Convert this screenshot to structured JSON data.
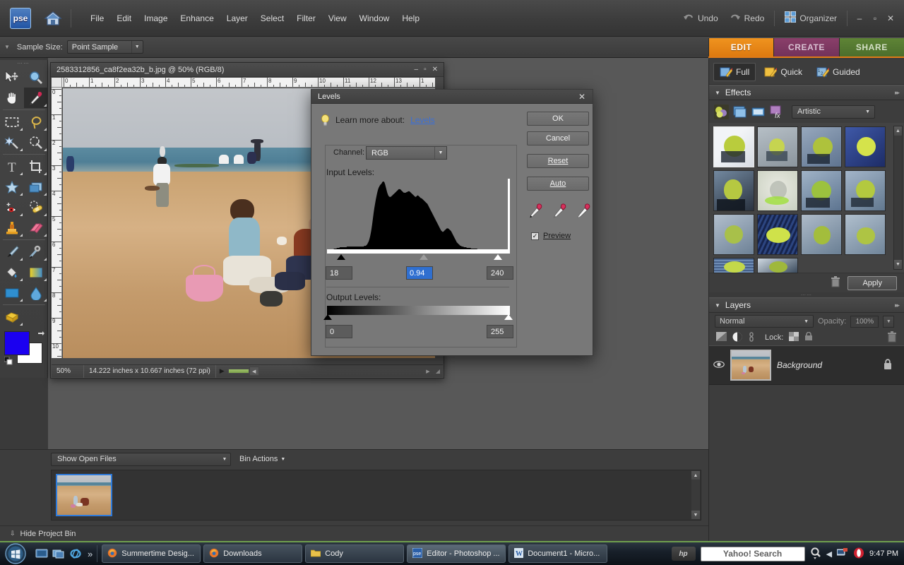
{
  "app": {
    "logo_text": "pse",
    "menus": [
      "File",
      "Edit",
      "Image",
      "Enhance",
      "Layer",
      "Select",
      "Filter",
      "View",
      "Window",
      "Help"
    ],
    "undo_label": "Undo",
    "redo_label": "Redo",
    "organizer_label": "Organizer",
    "window_buttons": [
      "–",
      "▫",
      "✕"
    ],
    "home_icon": "home-icon",
    "undo_icon": "undo-arrow-icon",
    "redo_icon": "redo-arrow-icon",
    "organizer_icon": "grid-squares-icon"
  },
  "options_bar": {
    "grip_icon": "collapse-triangle-icon",
    "sample_size_label": "Sample Size:",
    "sample_size_value": "Point Sample"
  },
  "mode_tabs": [
    {
      "label": "EDIT",
      "active": true,
      "color": "#e68a1c"
    },
    {
      "label": "CREATE",
      "active": false,
      "color": "#7f3a61"
    },
    {
      "label": "SHARE",
      "active": false,
      "color": "#55792f"
    }
  ],
  "edit_modes": [
    {
      "label": "Full",
      "active": true,
      "icon": "pencil-photo-icon"
    },
    {
      "label": "Quick",
      "active": false,
      "icon": "pencil-photo-icon"
    },
    {
      "label": "Guided",
      "active": false,
      "icon": "numbered-pencil-icon"
    }
  ],
  "effects_panel": {
    "title": "Effects",
    "collapse_icon": "triangle-down-icon",
    "expand_icon": "double-chevron-right-icon",
    "category_buttons": [
      {
        "name": "filters-icon"
      },
      {
        "name": "layer-styles-icon"
      },
      {
        "name": "photo-effects-icon"
      },
      {
        "name": "fx-effects-icon"
      }
    ],
    "category_value": "Artistic",
    "thumbnails": [
      {
        "id": 1,
        "selected": true
      },
      {
        "id": 2,
        "selected": false
      },
      {
        "id": 3,
        "selected": false
      },
      {
        "id": 4,
        "selected": false
      },
      {
        "id": 5,
        "selected": false
      },
      {
        "id": 6,
        "selected": false
      },
      {
        "id": 7,
        "selected": false
      },
      {
        "id": 8,
        "selected": false
      },
      {
        "id": 9,
        "selected": false
      },
      {
        "id": 10,
        "selected": false
      },
      {
        "id": 11,
        "selected": false
      },
      {
        "id": 12,
        "selected": false
      },
      {
        "id": 13,
        "selected": false
      },
      {
        "id": 14,
        "selected": false
      }
    ],
    "trash_icon": "trash-icon",
    "apply_label": "Apply"
  },
  "layers_panel": {
    "title": "Layers",
    "collapse_icon": "triangle-down-icon",
    "expand_icon": "double-chevron-right-icon",
    "blend_mode": "Normal",
    "opacity_label": "Opacity:",
    "opacity_value": "100%",
    "lock_label": "Lock:",
    "icons": [
      "new-fill-layer-icon",
      "new-adjustment-layer-icon",
      "link-layers-icon",
      "lock-transparency-icon",
      "lock-all-icon",
      "trash-icon"
    ],
    "layers": [
      {
        "name": "Background",
        "visible": true,
        "locked": true,
        "visibility_icon": "eye-icon",
        "lock_icon": "padlock-icon"
      }
    ]
  },
  "toolbox": {
    "grip_icon": "dots-grip-icon",
    "tools": [
      {
        "name": "move-tool",
        "selected": false
      },
      {
        "name": "zoom-tool",
        "selected": false
      },
      {
        "name": "hand-tool",
        "selected": false
      },
      {
        "name": "eyedropper-tool",
        "selected": true
      },
      {
        "name": "rectangular-marquee-tool",
        "selected": false
      },
      {
        "name": "lasso-tool",
        "selected": false
      },
      {
        "name": "magic-wand-tool",
        "selected": false
      },
      {
        "name": "quick-selection-tool",
        "selected": false
      },
      {
        "name": "type-tool",
        "selected": false
      },
      {
        "name": "crop-tool",
        "selected": false
      },
      {
        "name": "cookie-cutter-tool",
        "selected": false
      },
      {
        "name": "straighten-tool",
        "selected": false
      },
      {
        "name": "red-eye-removal-tool",
        "selected": false
      },
      {
        "name": "healing-brush-tool",
        "selected": false
      },
      {
        "name": "clone-stamp-tool",
        "selected": false
      },
      {
        "name": "eraser-tool",
        "selected": false
      },
      {
        "name": "brush-tool",
        "selected": false
      },
      {
        "name": "smart-brush-tool",
        "selected": false
      },
      {
        "name": "paint-bucket-tool",
        "selected": false
      },
      {
        "name": "gradient-tool",
        "selected": false
      },
      {
        "name": "shape-tool",
        "selected": false
      },
      {
        "name": "blur-tool",
        "selected": false
      },
      {
        "name": "sponge-tool",
        "selected": false
      }
    ],
    "foreground_color": "#1b00f0",
    "background_color": "#ffffff",
    "swap_icon": "swap-colors-icon",
    "default_colors_icon": "default-colors-icon"
  },
  "document": {
    "title": "2583312856_ca8f2ea32b_b.jpg @ 50% (RGB/8)",
    "window_buttons": [
      "–",
      "▫",
      "✕"
    ],
    "zoom_level": "50%",
    "dimensions": "14.222 inches x 10.667 inches (72 ppi)",
    "ruler_h_labels": [
      "0",
      "1",
      "2",
      "3",
      "4",
      "5",
      "6",
      "7",
      "8",
      "9",
      "10",
      "11",
      "12",
      "13",
      "1"
    ],
    "ruler_v_labels": [
      "0",
      "1",
      "2",
      "3",
      "4",
      "5",
      "6",
      "7",
      "8",
      "9",
      "10"
    ],
    "status_play_icon": "play-triangle-icon"
  },
  "levels_dialog": {
    "title": "Levels",
    "close_icon": "close-x-icon",
    "bulb_icon": "lightbulb-icon",
    "learn_more_prefix": "Learn more about:",
    "learn_more_link": "Levels",
    "channel_label": "Channel:",
    "channel_value": "RGB",
    "input_levels_label": "Input Levels:",
    "input_black": "18",
    "input_gamma": "0.94",
    "input_white": "240",
    "gamma_selected": true,
    "output_levels_label": "Output Levels:",
    "output_black": "0",
    "output_white": "255",
    "buttons": [
      {
        "label": "OK",
        "name": "ok-button"
      },
      {
        "label": "Cancel",
        "name": "cancel-button"
      },
      {
        "label": "Reset",
        "name": "reset-button"
      },
      {
        "label": "Auto",
        "name": "auto-button"
      }
    ],
    "eyedroppers": [
      "set-black-point-eyedropper",
      "set-gray-point-eyedropper",
      "set-white-point-eyedropper"
    ],
    "preview_label": "Preview",
    "preview_checked": true,
    "histogram": [
      2,
      2,
      2,
      2,
      2,
      2,
      3,
      3,
      3,
      3,
      4,
      4,
      4,
      4,
      5,
      5,
      5,
      5,
      6,
      6,
      6,
      6,
      6,
      6,
      6,
      6,
      6,
      6,
      7,
      7,
      7,
      7,
      7,
      7,
      7,
      7,
      7,
      7,
      7,
      7,
      7,
      7,
      7,
      7,
      7,
      7,
      7,
      7,
      7,
      7,
      7,
      7,
      8,
      8,
      8,
      9,
      10,
      12,
      14,
      17,
      21,
      26,
      32,
      39,
      47,
      55,
      62,
      68,
      74,
      79,
      84,
      88,
      91,
      93,
      95,
      96,
      97,
      99,
      100,
      100,
      99,
      96,
      92,
      88,
      84,
      81,
      79,
      78,
      78,
      78,
      79,
      80,
      81,
      82,
      83,
      84,
      85,
      86,
      87,
      88,
      89,
      89,
      89,
      88,
      87,
      86,
      85,
      84,
      84,
      84,
      84,
      85,
      85,
      86,
      86,
      86,
      85,
      84,
      83,
      82,
      81,
      80,
      79,
      78,
      78,
      79,
      80,
      80,
      79,
      78,
      77,
      76,
      76,
      75,
      74,
      73,
      72,
      71,
      70,
      69,
      68,
      66,
      64,
      62,
      60,
      58,
      56,
      54,
      52,
      50,
      48,
      46,
      44,
      42,
      40,
      38,
      36,
      34,
      32,
      30,
      29,
      28,
      28,
      29,
      30,
      31,
      32,
      33,
      33,
      33,
      32,
      31,
      30,
      29,
      27,
      25,
      23,
      21,
      19,
      17,
      15,
      13,
      12,
      11,
      10,
      9,
      8,
      8,
      7,
      7,
      7,
      6,
      6,
      6,
      6,
      5,
      5,
      5,
      5,
      5,
      5,
      4,
      4,
      4,
      4,
      4,
      4,
      4,
      4,
      4,
      3,
      3,
      3,
      3,
      3,
      3,
      3,
      3,
      3,
      3,
      3,
      3,
      3,
      3,
      3,
      3,
      3,
      3,
      3,
      3,
      3,
      3,
      3,
      3,
      3,
      3,
      3,
      3,
      3,
      3,
      3,
      3,
      3,
      3,
      3,
      3,
      3,
      3,
      3,
      2,
      2,
      2,
      2,
      2,
      2,
      2
    ]
  },
  "project_bin": {
    "filter_value": "Show Open Files",
    "bin_actions_label": "Bin Actions",
    "bin_actions_icon": "triangle-down-icon",
    "hide_label": "Hide Project Bin",
    "hide_icon": "double-chevron-down-icon",
    "thumbnails": [
      {
        "selected": true
      }
    ]
  },
  "taskbar": {
    "start_icon": "windows-start-orb",
    "quick_launch": [
      {
        "name": "show-desktop-icon"
      },
      {
        "name": "switch-windows-icon"
      },
      {
        "name": "internet-explorer-icon"
      }
    ],
    "overflow_icon": "double-chevron-right-icon",
    "items": [
      {
        "label": "Summertime Desig...",
        "icon": "firefox-icon",
        "active": false
      },
      {
        "label": "Downloads",
        "icon": "firefox-icon",
        "active": false
      },
      {
        "label": "Cody",
        "icon": "folder-icon",
        "active": false
      },
      {
        "label": "Editor - Photoshop ...",
        "icon": "pse-icon",
        "active": true
      },
      {
        "label": "Document1 - Micro...",
        "icon": "word-icon",
        "active": false
      }
    ],
    "hp_label": "hp",
    "search_placeholder": "Yahoo! Search",
    "search_icon": "magnifier-icon",
    "tray_icons": [
      "show-hidden-icons-chevron",
      "network-icon",
      "opera-icon"
    ],
    "clock": "9:47 PM"
  }
}
